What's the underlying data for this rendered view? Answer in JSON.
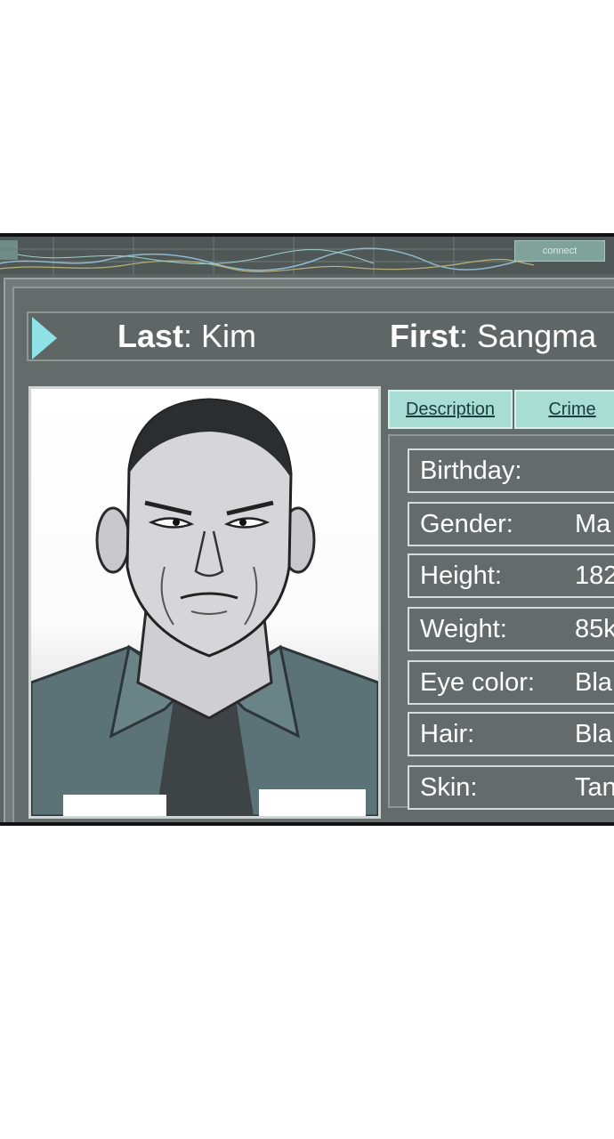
{
  "topbar": {
    "connect_label": "connect"
  },
  "namebar": {
    "last_label": "Last",
    "last_value": "Kim",
    "first_label": "First",
    "first_value": "Sangma"
  },
  "tabs": [
    {
      "label": "Description"
    },
    {
      "label": "Crime"
    }
  ],
  "details": [
    {
      "label": "Birthday:",
      "value": ""
    },
    {
      "label": "Gender:",
      "value": "Ma"
    },
    {
      "label": "Height:",
      "value": "182"
    },
    {
      "label": "Weight:",
      "value": "85k"
    },
    {
      "label": "Eye color:",
      "value": "Bla"
    },
    {
      "label": "Hair:",
      "value": "Bla"
    },
    {
      "label": "Skin:",
      "value": "Tan"
    }
  ],
  "colors": {
    "panel_bg": "#5d6563",
    "tab_bg": "#a8ddd3",
    "arrow": "#8fe3e8"
  }
}
